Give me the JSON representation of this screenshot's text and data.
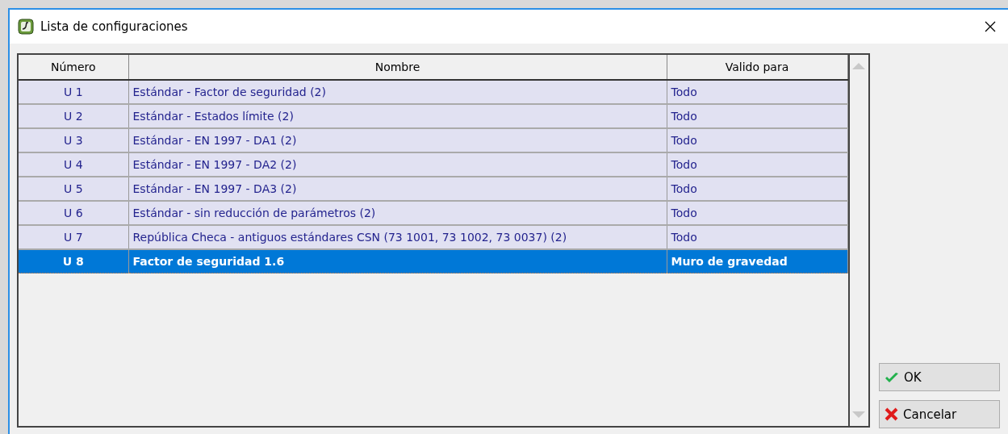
{
  "window": {
    "title": "Lista de configuraciones"
  },
  "table": {
    "columns": [
      "Número",
      "Nombre",
      "Valido para"
    ],
    "rows": [
      {
        "number": "U 1",
        "name": "Estándar - Factor de seguridad (2)",
        "valid_for": "Todo",
        "selected": false
      },
      {
        "number": "U 2",
        "name": "Estándar - Estados límite (2)",
        "valid_for": "Todo",
        "selected": false
      },
      {
        "number": "U 3",
        "name": "Estándar - EN 1997 - DA1 (2)",
        "valid_for": "Todo",
        "selected": false
      },
      {
        "number": "U 4",
        "name": "Estándar - EN 1997 - DA2 (2)",
        "valid_for": "Todo",
        "selected": false
      },
      {
        "number": "U 5",
        "name": "Estándar - EN 1997 - DA3 (2)",
        "valid_for": "Todo",
        "selected": false
      },
      {
        "number": "U 6",
        "name": "Estándar - sin reducción de parámetros (2)",
        "valid_for": "Todo",
        "selected": false
      },
      {
        "number": "U 7",
        "name": "República Checa - antiguos estándares CSN (73 1001, 73 1002, 73 0037) (2)",
        "valid_for": "Todo",
        "selected": false
      },
      {
        "number": "U 8",
        "name": "Factor de seguridad 1.6",
        "valid_for": "Muro de gravedad",
        "selected": true
      }
    ]
  },
  "buttons": [
    {
      "kind": "ok",
      "label": "OK"
    },
    {
      "kind": "cancel",
      "label": "Cancelar"
    }
  ]
}
